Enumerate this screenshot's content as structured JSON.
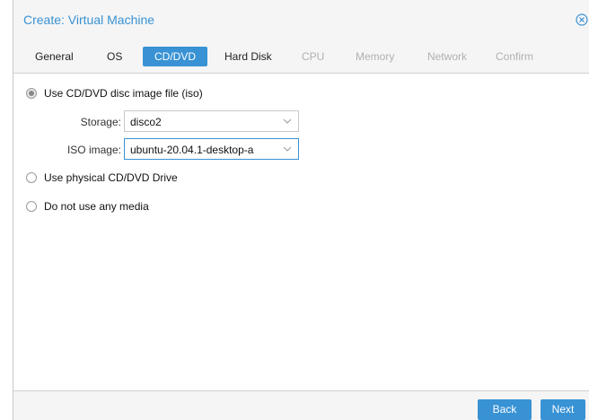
{
  "window": {
    "title": "Create: Virtual Machine",
    "close_icon": "close-circle-icon",
    "accent_color": "#3892d4"
  },
  "tabs": [
    {
      "label": "General",
      "state": "enabled"
    },
    {
      "label": "OS",
      "state": "enabled"
    },
    {
      "label": "CD/DVD",
      "state": "active"
    },
    {
      "label": "Hard Disk",
      "state": "enabled"
    },
    {
      "label": "CPU",
      "state": "disabled"
    },
    {
      "label": "Memory",
      "state": "disabled"
    },
    {
      "label": "Network",
      "state": "disabled"
    },
    {
      "label": "Confirm",
      "state": "disabled"
    }
  ],
  "media": {
    "option_iso": {
      "label": "Use CD/DVD disc image file (iso)",
      "checked": true
    },
    "storage": {
      "label": "Storage:",
      "value": "disco2"
    },
    "iso_image": {
      "label": "ISO image:",
      "value": "ubuntu-20.04.1-desktop-a"
    },
    "option_physical": {
      "label": "Use physical CD/DVD Drive",
      "checked": false
    },
    "option_none": {
      "label": "Do not use any media",
      "checked": false
    }
  },
  "footer": {
    "back_label": "Back",
    "next_label": "Next"
  }
}
